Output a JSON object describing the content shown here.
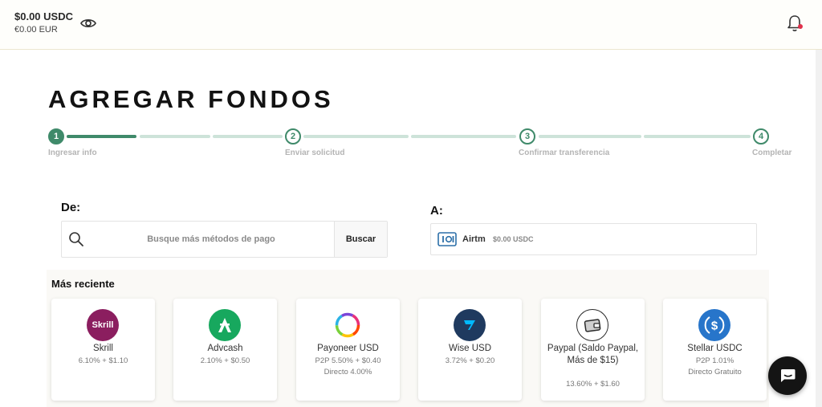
{
  "header": {
    "balance_main": "$0.00 USDC",
    "balance_sub": "€0.00 EUR"
  },
  "page": {
    "title": "AGREGAR FONDOS"
  },
  "stepper": {
    "steps": [
      {
        "number": "1",
        "label": "Ingresar info"
      },
      {
        "number": "2",
        "label": "Enviar solicitud"
      },
      {
        "number": "3",
        "label": "Confirmar transferencia"
      },
      {
        "number": "4",
        "label": "Completar"
      }
    ]
  },
  "from": {
    "label": "De:",
    "search_placeholder": "Busque más métodos de pago",
    "search_button": "Buscar"
  },
  "to": {
    "label": "A:",
    "account_name": "Airtm",
    "account_balance": "$0.00 USDC"
  },
  "recent": {
    "title": "Más reciente",
    "items": [
      {
        "name": "Skrill",
        "fee_line1": "6.10% + $1.10",
        "fee_line2": "",
        "color": "#8b1e5f"
      },
      {
        "name": "Advcash",
        "fee_line1": "2.10% + $0.50",
        "fee_line2": "",
        "color": "#17a85e"
      },
      {
        "name": "Payoneer USD",
        "fee_line1": "P2P 5.50% + $0.40",
        "fee_line2": "Directo 4.00%",
        "color": "#ff4800"
      },
      {
        "name": "Wise USD",
        "fee_line1": "3.72% + $0.20",
        "fee_line2": "",
        "color": "#1f3a5f"
      },
      {
        "name": "Paypal (Saldo Paypal, Más de $15)",
        "fee_line1": "13.60% + $1.60",
        "fee_line2": "",
        "color": "#2a2a2a"
      },
      {
        "name": "Stellar USDC",
        "fee_line1": "P2P 1.01%",
        "fee_line2": "Directo Gratuito",
        "color": "#2775ca"
      }
    ]
  },
  "colors": {
    "accent": "#3f8a6a",
    "accent_light": "#cde3d9",
    "notification": "#e0314b"
  }
}
